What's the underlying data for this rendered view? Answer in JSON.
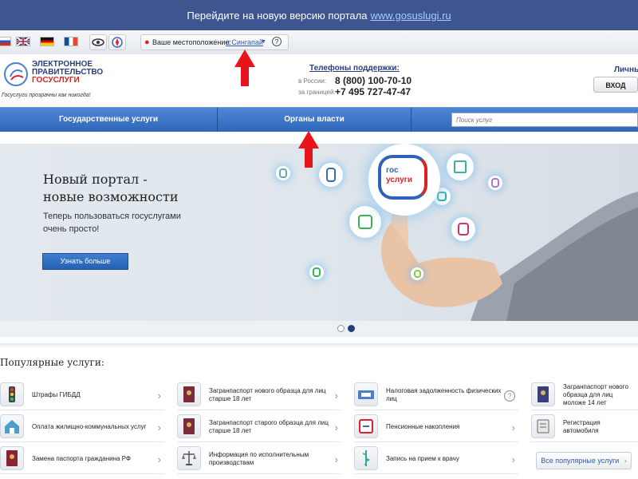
{
  "banner": {
    "text": "Перейдите на новую версию портала",
    "link": "www.gosuslugi.ru"
  },
  "location": {
    "label": "Ваше местоположение:",
    "value": "п Сингапай"
  },
  "logo": {
    "line1": "ЭЛЕКТРОННОЕ",
    "line2": "ПРАВИТЕЛЬСТВО",
    "line3": "ГОСУСЛУГИ",
    "slogan": "Госуслуги прозрачны как никогда!"
  },
  "support": {
    "title": "Телефоны поддержки:",
    "russia_label": "в России:",
    "russia_phone": "8 (800) 100-70-10",
    "abroad_label": "за границей:",
    "abroad_phone": "+7 495 727-47-47"
  },
  "account": {
    "label": "Личны",
    "login": "ВХОД"
  },
  "nav": {
    "item1": "Государственные услуги",
    "item2": "Органы власти",
    "search_placeholder": "Поиск услуг"
  },
  "hero": {
    "title_line1": "Новый портал -",
    "title_line2": "новые возможности",
    "sub_line1": "Теперь пользоваться госуслугами",
    "sub_line2": "очень просто!",
    "button": "Узнать больше",
    "logo_line1": "гос",
    "logo_line2": "услуги"
  },
  "slider": {
    "active_index": 2,
    "total": 2
  },
  "popular": {
    "title": "Популярные услуги:",
    "items": [
      {
        "label": "Штрафы ГИБДД",
        "icon": "traffic-light-icon"
      },
      {
        "label": "Загранпаспорт нового образца для лиц старше 18 лет",
        "icon": "passport-icon"
      },
      {
        "label": "Налоговая задолженность физических лиц",
        "icon": "tax-icon"
      },
      {
        "label": "Загранпаспорт нового образца для лиц моложе 14 лет",
        "icon": "passport-icon"
      },
      {
        "label": "Оплата жилищно-коммунальных услуг",
        "icon": "house-icon"
      },
      {
        "label": "Загранпаспорт старого образца для лиц старше 18 лет",
        "icon": "passport-icon"
      },
      {
        "label": "Пенсионные накопления",
        "icon": "pension-icon"
      },
      {
        "label": "Регистрация автомобиля",
        "icon": "car-icon"
      },
      {
        "label": "Замена паспорта гражданина РФ",
        "icon": "id-card-icon"
      },
      {
        "label": "Информация по исполнительным производствам",
        "icon": "scales-icon"
      },
      {
        "label": "Запись на прием к врачу",
        "icon": "medical-icon"
      }
    ],
    "all_button": "Все популярные услуги"
  }
}
